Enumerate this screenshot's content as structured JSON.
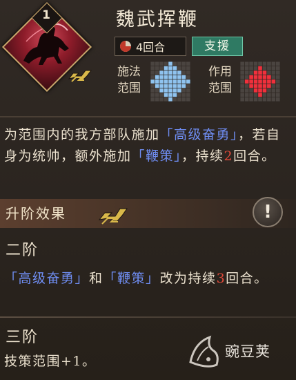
{
  "skill": {
    "title": "魏武挥鞭",
    "level": "1",
    "rounds": "4回合",
    "type": "支援",
    "cast_range_label_1": "施法",
    "cast_range_label_2": "范围",
    "effect_range_label_1": "作用",
    "effect_range_label_2": "范围"
  },
  "description": {
    "p1": "为范围内的我方部队施加",
    "kw1": "「高级奋勇」",
    "p2": "，若自身为统帅，额外施加",
    "kw2": "「鞭策」",
    "p3": "，持续",
    "num": "2",
    "p4": "回合。"
  },
  "upgrade": {
    "header": "升阶效果",
    "info_button": "!",
    "tier2_title": "二阶",
    "tier2_kw1": "「高级奋勇」",
    "tier2_p1": "和",
    "tier2_kw2": "「鞭策」",
    "tier2_p2": "改为持续",
    "tier2_num": "3",
    "tier2_p3": "回合。",
    "tier3_title": "三阶",
    "tier3_text": "技策范围+1。"
  },
  "watermark": {
    "text": "豌豆荚"
  },
  "colors": {
    "keyword": "#6f8df2",
    "number": "#e04a3a",
    "support_badge": "#2f7a63",
    "cast_grid": "#8fc3ef",
    "effect_grid": "#f0303c"
  }
}
